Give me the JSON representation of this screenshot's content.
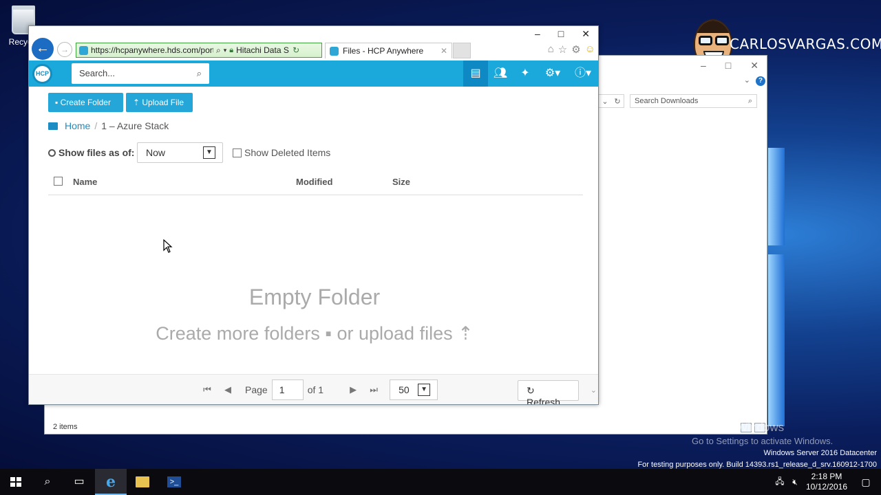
{
  "desktop": {
    "recycle_label": "Recycle",
    "logo_text": "CARLOSVARGAS.COM",
    "activate_title": "Activate Windows",
    "activate_sub": "Go to Settings to activate Windows.",
    "edition": "Windows Server 2016 Datacenter",
    "build": "For testing purposes only. Build 14393.rs1_release_d_srv.160912-1700"
  },
  "explorer": {
    "search_placeholder": "Search Downloads",
    "status": "2 items"
  },
  "browser": {
    "url": "https://hcpanywhere.hds.com/porta",
    "cert": "Hitachi Data S...",
    "tab_title": "Files - HCP Anywhere"
  },
  "app": {
    "logo": "HCP",
    "search_placeholder": "Search...",
    "create_folder": "Create Folder",
    "upload_file": "Upload File",
    "breadcrumb_home": "Home",
    "breadcrumb_sep": "/",
    "breadcrumb_current": "1 – Azure Stack",
    "show_files_label": "Show files as of:",
    "show_files_value": "Now",
    "show_deleted": "Show Deleted Items",
    "columns": {
      "name": "Name",
      "modified": "Modified",
      "size": "Size"
    },
    "empty_title": "Empty Folder",
    "empty_sub": "Create more folders",
    "empty_sub2": "or upload files",
    "pager": {
      "label": "Page",
      "page": "1",
      "of": "of 1",
      "page_size": "50"
    },
    "refresh": "Refresh"
  },
  "taskbar": {
    "time": "2:18 PM",
    "date": "10/12/2016"
  },
  "colors": {
    "accent": "#1ba9dc",
    "button": "#25a6d8",
    "link": "#1c8cc3"
  }
}
